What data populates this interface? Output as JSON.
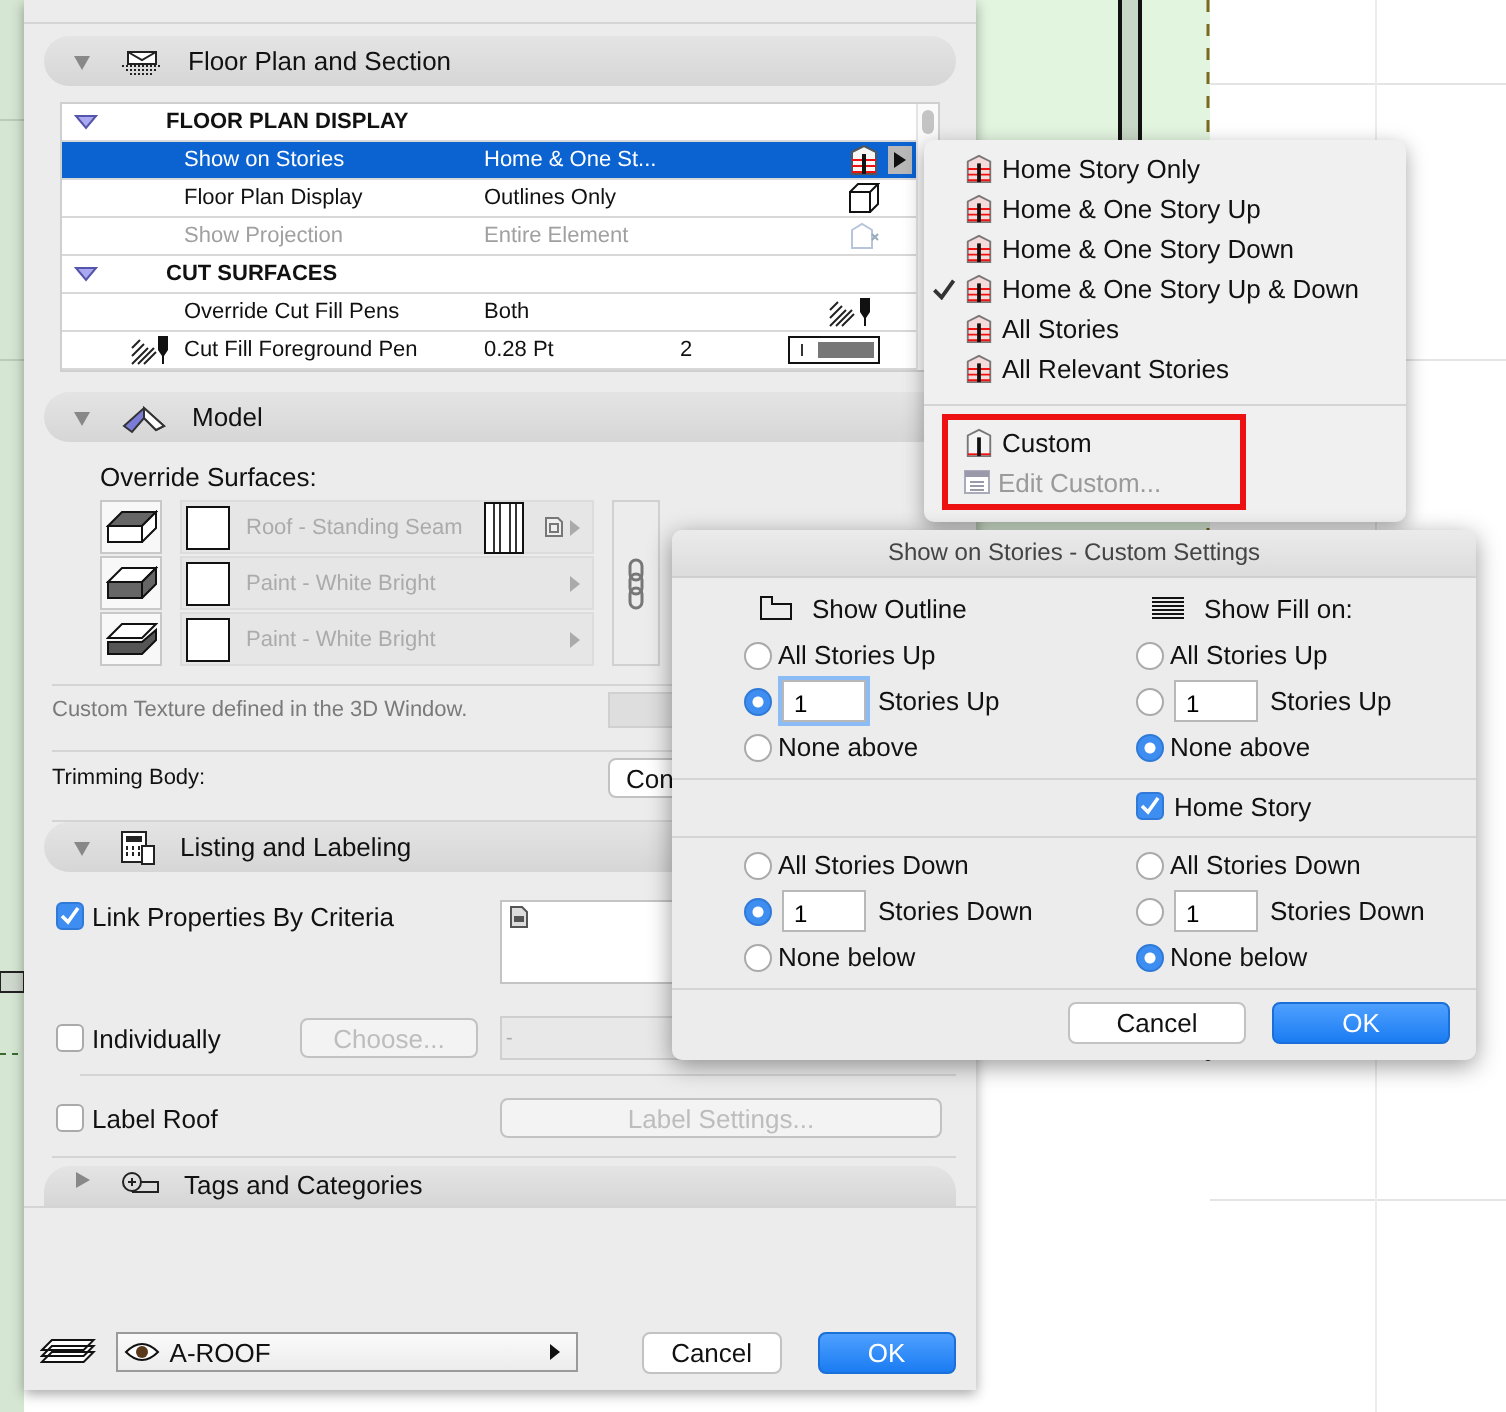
{
  "floor_plan_section": {
    "title": "Floor Plan and Section",
    "expanded": true,
    "groups": [
      {
        "title": "FLOOR PLAN DISPLAY",
        "expanded": true,
        "rows": [
          {
            "label": "Show on Stories",
            "value": "Home & One St...",
            "kind": "stories",
            "selected": true,
            "disabled": false
          },
          {
            "label": "Floor Plan Display",
            "value": "Outlines Only",
            "kind": "box",
            "selected": false,
            "disabled": false
          },
          {
            "label": "Show Projection",
            "value": "Entire Element",
            "kind": "projection",
            "selected": false,
            "disabled": true
          }
        ]
      },
      {
        "title": "CUT SURFACES",
        "expanded": true,
        "rows": [
          {
            "label": "Override Cut Fill Pens",
            "value": "Both",
            "kind": "pens",
            "selected": false,
            "disabled": false
          },
          {
            "label": "Cut Fill Foreground Pen",
            "value": "0.28 Pt",
            "number": "2",
            "kind": "pen-weight",
            "selected": false,
            "disabled": false
          }
        ]
      }
    ]
  },
  "model_section": {
    "title": "Model",
    "expanded": true,
    "override_label": "Override Surfaces:",
    "surfaces": [
      {
        "kind": "top",
        "material": "Roof - Standing Seam",
        "texture": true
      },
      {
        "kind": "side",
        "material": "Paint - White Bright",
        "texture": false
      },
      {
        "kind": "bottom",
        "material": "Paint - White Bright",
        "texture": false
      }
    ],
    "texture_note": "Custom Texture defined in the 3D Window.",
    "trimming_label": "Trimming Body:",
    "trimming_button": "Con"
  },
  "listing_section": {
    "title": "Listing and Labeling",
    "expanded": true,
    "link_properties": {
      "label": "Link Properties By Criteria",
      "checked": true
    },
    "individually": {
      "label": "Individually",
      "checked": false
    },
    "choose_button": "Choose...",
    "id_field": "-",
    "label_roof": {
      "label": "Label Roof",
      "checked": false
    },
    "label_settings_button": "Label Settings..."
  },
  "tags_section": {
    "title": "Tags and Categories",
    "expanded": false
  },
  "footer": {
    "layer": "A-ROOF",
    "cancel": "Cancel",
    "ok": "OK"
  },
  "stories_menu": {
    "items": [
      {
        "label": "Home Story Only",
        "checked": false,
        "disabled": false,
        "kind": "story"
      },
      {
        "label": "Home & One Story Up",
        "checked": false,
        "disabled": false,
        "kind": "story"
      },
      {
        "label": "Home & One Story Down",
        "checked": false,
        "disabled": false,
        "kind": "story"
      },
      {
        "label": "Home & One Story Up & Down",
        "checked": true,
        "disabled": false,
        "kind": "story"
      },
      {
        "label": "All Stories",
        "checked": false,
        "disabled": false,
        "kind": "story"
      },
      {
        "label": "All Relevant Stories",
        "checked": false,
        "disabled": false,
        "kind": "story"
      }
    ],
    "custom_group": {
      "highlighted": true,
      "items": [
        {
          "label": "Custom",
          "checked": false,
          "disabled": false,
          "kind": "story"
        },
        {
          "label": "Edit Custom...",
          "checked": false,
          "disabled": true,
          "kind": "list"
        }
      ]
    }
  },
  "custom_dialog": {
    "title": "Show on Stories - Custom Settings",
    "columns": [
      {
        "title": "Show Outline",
        "kind": "outline",
        "up": [
          {
            "label": "All Stories Up",
            "selected": false
          },
          {
            "label": "Stories Up",
            "value": "1",
            "focused": true,
            "selected": true
          },
          {
            "label": "None above",
            "selected": false
          }
        ],
        "down": [
          {
            "label": "All Stories Down",
            "selected": false
          },
          {
            "label": "Stories Down",
            "value": "1",
            "focused": false,
            "selected": true
          },
          {
            "label": "None below",
            "selected": false
          }
        ]
      },
      {
        "title": "Show Fill on:",
        "kind": "fill",
        "up": [
          {
            "label": "All Stories Up",
            "selected": false
          },
          {
            "label": "Stories Up",
            "value": "1",
            "focused": false,
            "selected": false
          },
          {
            "label": "None above",
            "selected": true
          }
        ],
        "down": [
          {
            "label": "All Stories Down",
            "selected": false
          },
          {
            "label": "Stories Down",
            "value": "1",
            "focused": false,
            "selected": false
          },
          {
            "label": "None below",
            "selected": true
          }
        ]
      }
    ],
    "home_story": {
      "label": "Home Story",
      "checked": true
    },
    "cancel": "Cancel",
    "ok": "OK"
  }
}
